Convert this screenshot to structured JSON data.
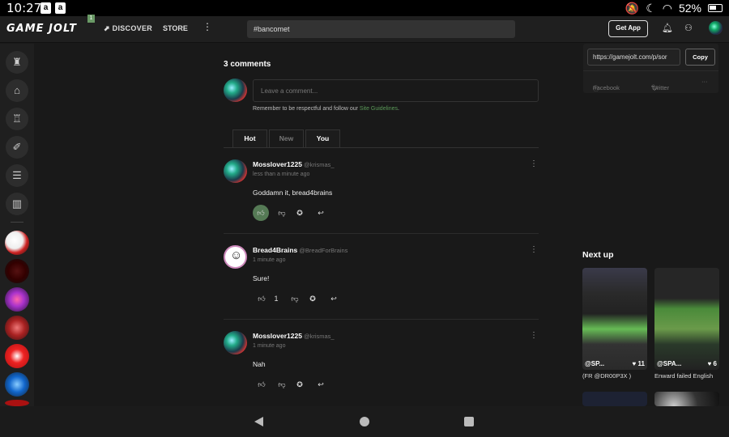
{
  "status": {
    "time": "10:27",
    "apps": [
      "a",
      "a"
    ],
    "battery": "52%"
  },
  "topbar": {
    "logo": "GAME JOLT",
    "logo_badge": "1",
    "discover": "DISCOVER",
    "store": "STORE",
    "more": "⋮",
    "search_value": "#bancomet",
    "get_app": "Get App"
  },
  "left_sidebar": {
    "icons": [
      "trophy-icon",
      "store-icon",
      "cake-icon",
      "broom-icon",
      "chat-icon",
      "library-icon"
    ]
  },
  "comments": {
    "title": "3 comments",
    "input_placeholder": "Leave a comment...",
    "reminder_prefix": "Remember to be respectful and follow our ",
    "reminder_link": "Site Guidelines",
    "reminder_suffix": ".",
    "tabs": [
      {
        "label": "Hot",
        "active": true
      },
      {
        "label": "New",
        "active": false
      },
      {
        "label": "You",
        "active": true
      }
    ],
    "items": [
      {
        "author": "Mosslover1225",
        "handle": "@krismas_",
        "time": "less than a minute ago",
        "body": "Goddamn it, bread4brains",
        "likes": "",
        "liked": true
      },
      {
        "author": "Bread4Brains",
        "handle": "@BreadForBrains",
        "time": "1 minute ago",
        "body": "Sure!",
        "likes": "1",
        "liked": false
      },
      {
        "author": "Mosslover1225",
        "handle": "@krismas_",
        "time": "1 minute ago",
        "body": "Nah",
        "likes": "",
        "liked": false
      }
    ]
  },
  "share": {
    "url": "https://gamejolt.com/p/sor",
    "copy": "Copy",
    "facebook": "Facebook",
    "twitter": "Twitter",
    "more": "···"
  },
  "next_up": {
    "title": "Next up",
    "items": [
      {
        "user": "@SP...",
        "likes": "11",
        "caption": "(FR @DR00P3X )"
      },
      {
        "user": "@SPA...",
        "likes": "6",
        "caption": "Enward failed English"
      }
    ]
  }
}
